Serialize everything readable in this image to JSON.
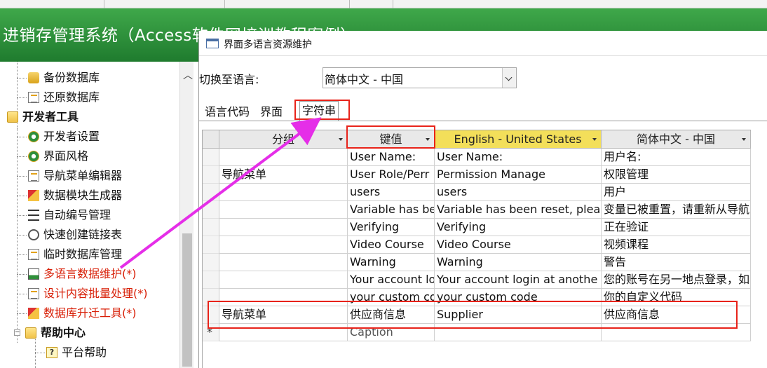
{
  "app": {
    "title": "进销存管理系统（Access软件网培训教程案例）"
  },
  "sidebar": {
    "items": [
      {
        "label": "备份数据库",
        "icon": "database-icon"
      },
      {
        "label": "还原数据库",
        "icon": "restore-icon"
      },
      {
        "label": "开发者工具",
        "icon": "folder-icon"
      },
      {
        "label": "开发者设置",
        "icon": "gear-icon"
      },
      {
        "label": "界面风格",
        "icon": "palette-icon"
      },
      {
        "label": "导航菜单编辑器",
        "icon": "edit-icon"
      },
      {
        "label": "数据模块生成器",
        "icon": "brush-icon"
      },
      {
        "label": "自动编号管理",
        "icon": "list-icon"
      },
      {
        "label": "快速创建链接表",
        "icon": "link-icon"
      },
      {
        "label": "临时数据库管理",
        "icon": "edit-icon"
      },
      {
        "label": "多语言数据维护(*)",
        "icon": "chart-icon"
      },
      {
        "label": "设计内容批量处理(*)",
        "icon": "edit-icon"
      },
      {
        "label": "数据库升迁工具(*)",
        "icon": "brush-icon"
      },
      {
        "label": "帮助中心",
        "icon": "folder-icon"
      },
      {
        "label": "平台帮助",
        "icon": "help-icon"
      }
    ]
  },
  "dialog": {
    "title": "界面多语言资源维护",
    "switch_label": "切换至语言:",
    "language_selected": "简体中文 - 中国",
    "tabs": [
      "语言代码",
      "界面",
      "字符串"
    ],
    "active_tab": "字符串",
    "columns": [
      "分组",
      "键值",
      "English - United States",
      "简体中文 - 中国"
    ],
    "rows": [
      {
        "group": "",
        "key": "User Name:",
        "en": "User Name:",
        "zh": "用户名:"
      },
      {
        "group": "导航菜单",
        "key": "User Role/Perr",
        "en": "Permission Manage",
        "zh": "权限管理"
      },
      {
        "group": "",
        "key": "users",
        "en": "users",
        "zh": "用户"
      },
      {
        "group": "",
        "key": "Variable has be",
        "en": "Variable has been reset, plea",
        "zh": "变量已被重置，请重新从导航"
      },
      {
        "group": "",
        "key": "Verifying",
        "en": "Verifying",
        "zh": "正在验证"
      },
      {
        "group": "",
        "key": "Video Course",
        "en": "Video Course",
        "zh": "视频课程"
      },
      {
        "group": "",
        "key": "Warning",
        "en": "Warning",
        "zh": "警告"
      },
      {
        "group": "",
        "key": "Your account lo",
        "en": "Your account login at anothe",
        "zh": "您的账号在另一地点登录，如"
      },
      {
        "group": "",
        "key": "your custom co",
        "en": "your custom code",
        "zh": "你的自定义代码"
      },
      {
        "group": "导航菜单",
        "key": "供应商信息",
        "en": "Supplier",
        "zh": "供应商信息"
      }
    ],
    "new_row": {
      "marker": "*",
      "key": "Caption"
    }
  },
  "colors": {
    "banner": "#2a8f3a",
    "highlight_column": "#f3df5a",
    "annotation": "#e8231a",
    "arrow": "#e52ee8"
  }
}
